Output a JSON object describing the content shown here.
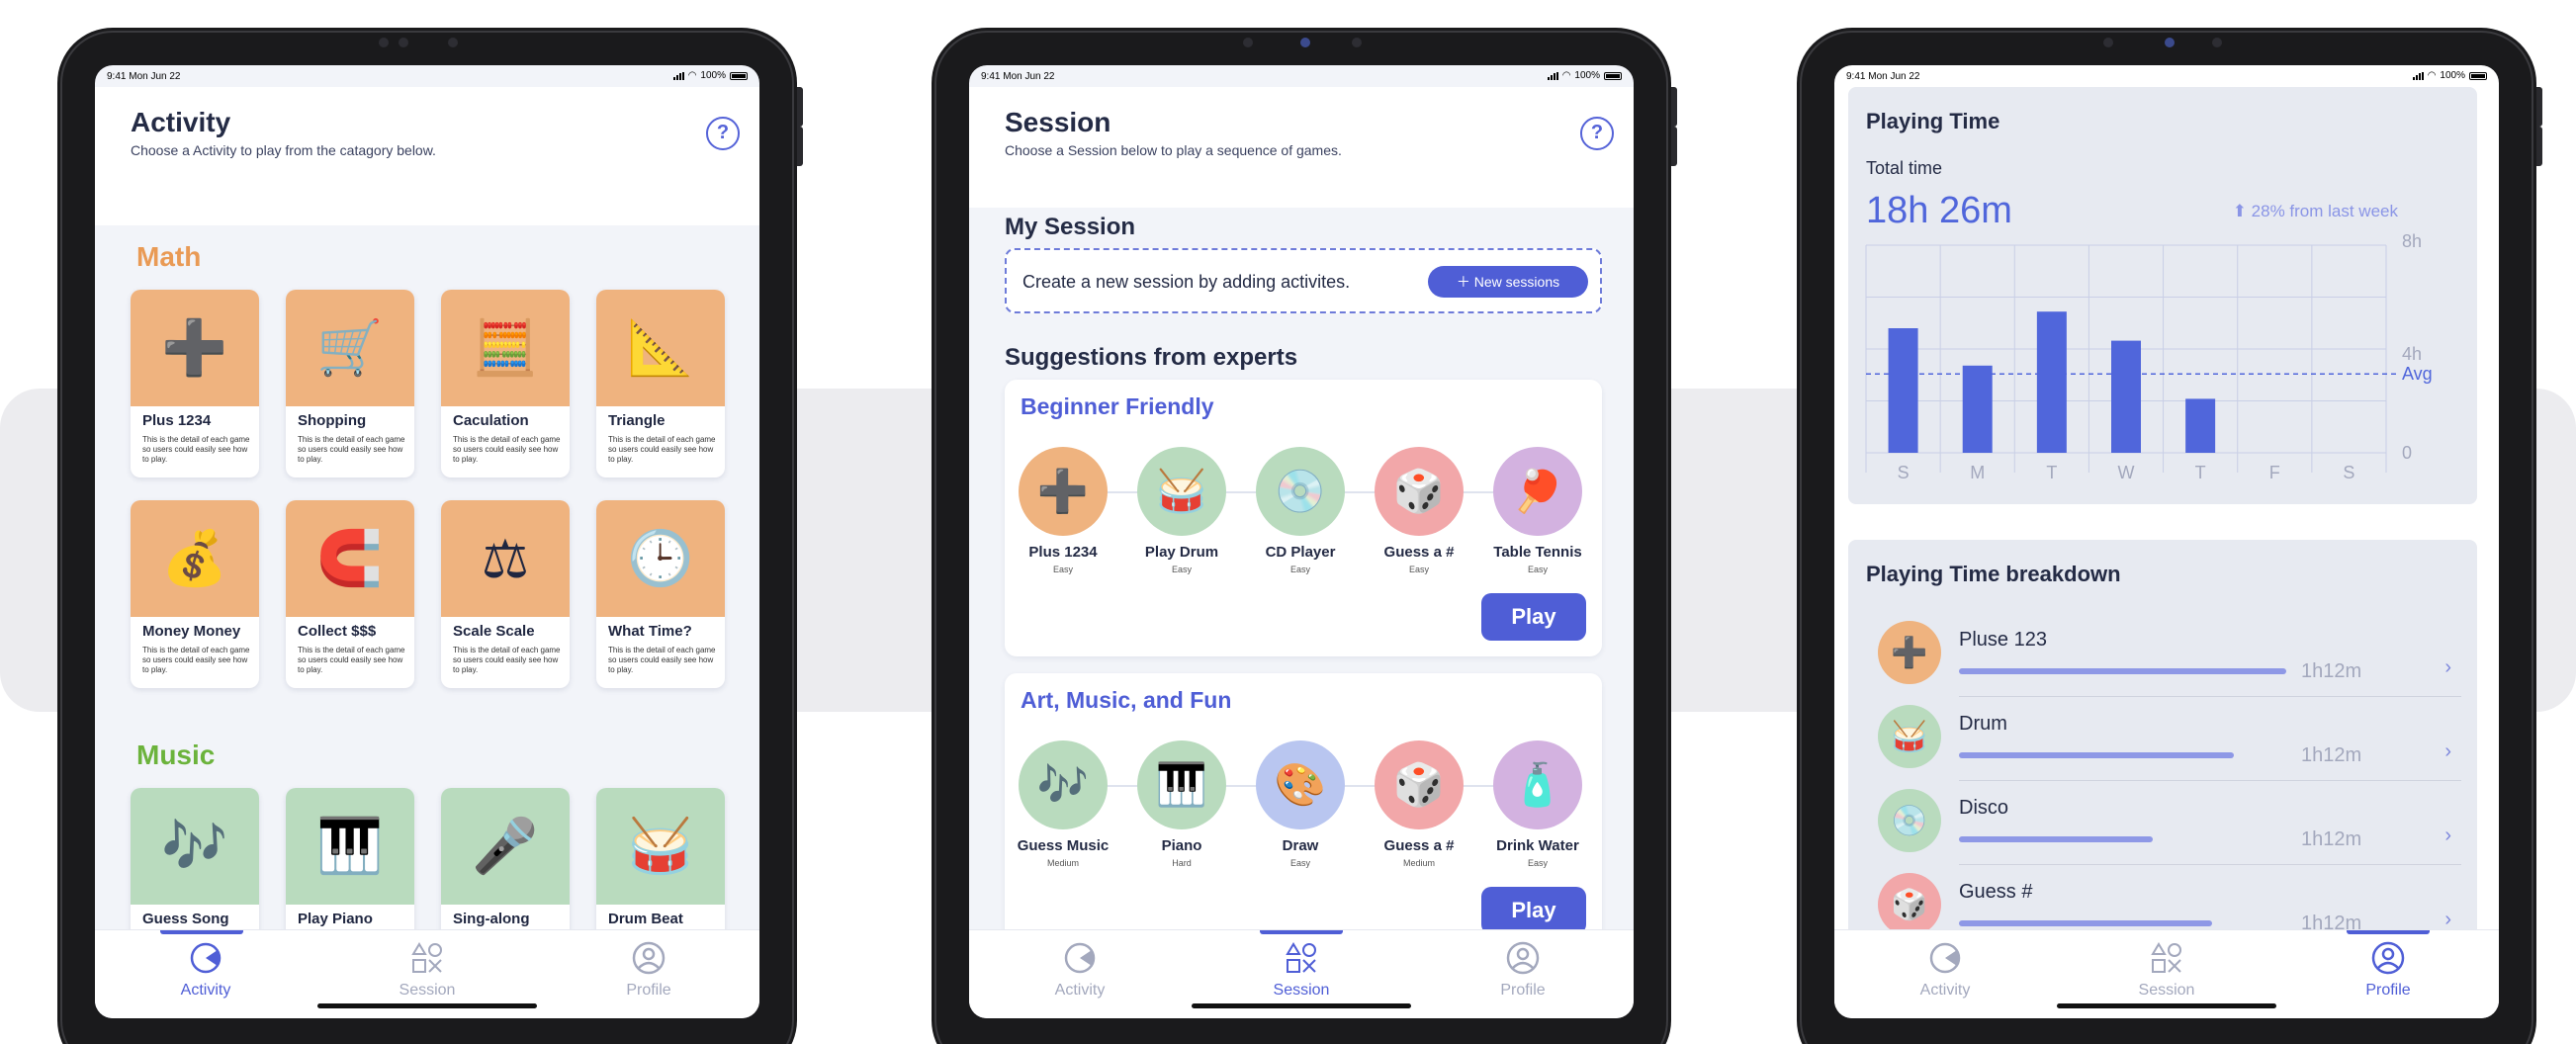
{
  "status": {
    "time": "9:41  Mon Jun 22",
    "battery": "100%"
  },
  "tabs": {
    "activity": "Activity",
    "session": "Session",
    "profile": "Profile"
  },
  "activity": {
    "title": "Activity",
    "subtitle": "Choose a Activity to play from the catagory below.",
    "help": "?",
    "math_heading": "Math",
    "music_heading": "Music",
    "card_desc": "This is the detail of each game so users could easily see how to play.",
    "math": [
      {
        "name": "Plus 1234",
        "icon": "plus-minus-blocks-icon",
        "glyph": "➕"
      },
      {
        "name": "Shopping",
        "icon": "shopping-cart-icon",
        "glyph": "🛒"
      },
      {
        "name": "Caculation",
        "icon": "calculator-icon",
        "glyph": "🧮"
      },
      {
        "name": "Triangle",
        "icon": "triangle-ruler-icon",
        "glyph": "📐"
      },
      {
        "name": "Money Money",
        "icon": "money-bag-icon",
        "glyph": "💰"
      },
      {
        "name": "Collect $$$",
        "icon": "magnet-coins-icon",
        "glyph": "🧲"
      },
      {
        "name": "Scale Scale",
        "icon": "balance-scale-icon",
        "glyph": "⚖"
      },
      {
        "name": "What Time?",
        "icon": "clock-icon",
        "glyph": "🕒"
      }
    ],
    "music": [
      {
        "name": "Guess Song",
        "icon": "music-notes-icon",
        "glyph": "🎶"
      },
      {
        "name": "Play Piano",
        "icon": "piano-icon",
        "glyph": "🎹"
      },
      {
        "name": "Sing-along",
        "icon": "microphone-icon",
        "glyph": "🎤"
      },
      {
        "name": "Drum Beat",
        "icon": "drum-icon",
        "glyph": "🥁"
      }
    ]
  },
  "session": {
    "title": "Session",
    "subtitle": "Choose a Session below to play a sequence of games.",
    "help": "?",
    "my_session": "My Session",
    "create_text": "Create a new session by adding activites.",
    "new_button": "New sessions",
    "suggestions": "Suggestions from experts",
    "play": "Play",
    "groups": [
      {
        "title": "Beginner Friendly",
        "items": [
          {
            "name": "Plus 1234",
            "level": "Easy",
            "icon": "plus-minus-blocks-icon",
            "glyph": "➕",
            "color": "#efb37f"
          },
          {
            "name": "Play Drum",
            "level": "Easy",
            "icon": "drum-icon",
            "glyph": "🥁",
            "color": "#b9dbbe"
          },
          {
            "name": "CD Player",
            "level": "Easy",
            "icon": "record-player-icon",
            "glyph": "💿",
            "color": "#b9dbbe"
          },
          {
            "name": "Guess a #",
            "level": "Easy",
            "icon": "dice-icon",
            "glyph": "🎲",
            "color": "#f2a7a9"
          },
          {
            "name": "Table Tennis",
            "level": "Easy",
            "icon": "ping-pong-icon",
            "glyph": "🏓",
            "color": "#d3b2e0"
          }
        ]
      },
      {
        "title": "Art, Music, and Fun",
        "items": [
          {
            "name": "Guess Music",
            "level": "Medium",
            "icon": "music-notes-icon",
            "glyph": "🎶",
            "color": "#b9dbbe"
          },
          {
            "name": "Piano",
            "level": "Hard",
            "icon": "piano-icon",
            "glyph": "🎹",
            "color": "#b9dbbe"
          },
          {
            "name": "Draw",
            "level": "Easy",
            "icon": "paint-palette-icon",
            "glyph": "🎨",
            "color": "#b9c6f0"
          },
          {
            "name": "Guess a #",
            "level": "Medium",
            "icon": "dice-icon",
            "glyph": "🎲",
            "color": "#f2a7a9"
          },
          {
            "name": "Drink Water",
            "level": "Easy",
            "icon": "water-bottle-icon",
            "glyph": "🧴",
            "color": "#d3b2e0"
          }
        ]
      }
    ]
  },
  "profile": {
    "playing_time": "Playing Time",
    "total_label": "Total time",
    "total_value": "18h 26m",
    "trend": "28% from last week",
    "breakdown_title": "Playing Time breakdown",
    "breakdown": [
      {
        "name": "Pluse 123",
        "time": "1h12m",
        "fraction": 0.88,
        "icon": "plus-minus-blocks-icon",
        "glyph": "➕",
        "color": "#efb37f"
      },
      {
        "name": "Drum",
        "time": "1h12m",
        "fraction": 0.74,
        "icon": "drum-icon",
        "glyph": "🥁",
        "color": "#b9dbbe"
      },
      {
        "name": "Disco",
        "time": "1h12m",
        "fraction": 0.52,
        "icon": "record-player-icon",
        "glyph": "💿",
        "color": "#b9dbbe"
      },
      {
        "name": "Guess #",
        "time": "1h12m",
        "fraction": 0.68,
        "icon": "dice-icon",
        "glyph": "🎲",
        "color": "#f2a7a9"
      }
    ]
  },
  "chart_data": {
    "type": "bar",
    "categories": [
      "S",
      "M",
      "T",
      "W",
      "T",
      "F",
      "S"
    ],
    "values": [
      6,
      4.2,
      6.8,
      5.4,
      2.6,
      0,
      0
    ],
    "ytick_labels": [
      "8h",
      "4h",
      "0"
    ],
    "ylim": [
      0,
      10
    ],
    "average_label": "Avg",
    "average_value": 3.8,
    "grid": true,
    "bar_color": "#5066db"
  },
  "colors": {
    "accent": "#4f5ed6",
    "math": "#e99a55",
    "music": "#6cb33c"
  }
}
